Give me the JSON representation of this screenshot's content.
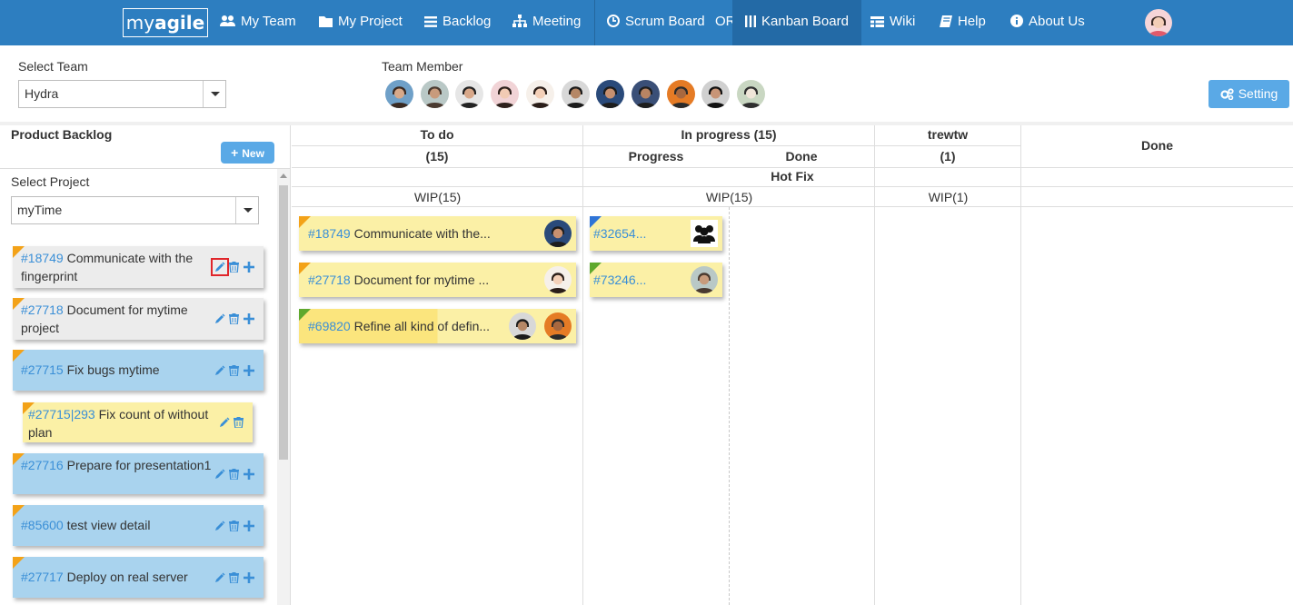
{
  "nav": {
    "logo_light": "my",
    "logo_bold": "agile",
    "items": [
      {
        "label": "My Team",
        "icon": "users-icon"
      },
      {
        "label": "My Project",
        "icon": "folder-icon"
      },
      {
        "label": "Backlog",
        "icon": "list-icon"
      },
      {
        "label": "Meeting",
        "icon": "sitemap-icon"
      },
      {
        "label": "Scrum Board",
        "icon": "clock-icon"
      },
      {
        "label": "Kanban Board",
        "icon": "columns-icon"
      },
      {
        "label": "Wiki",
        "icon": "table-icon"
      },
      {
        "label": "Help",
        "icon": "book-icon"
      },
      {
        "label": "About Us",
        "icon": "info-icon"
      }
    ],
    "or_label": "OR",
    "active": "Kanban Board",
    "color": "#2d7ec0"
  },
  "team": {
    "select_label": "Select Team",
    "selected": "Hydra",
    "member_label": "Team Member",
    "member_count": 11
  },
  "setting_label": "Setting",
  "backlog": {
    "title": "Product Backlog",
    "new_label": "New",
    "project_label": "Select Project",
    "project_selected": "myTime",
    "cards": [
      {
        "id": "#18749",
        "title": "Communicate with the fingerprint",
        "color": "grey"
      },
      {
        "id": "#27718",
        "title": "Document for mytime project",
        "color": "grey"
      },
      {
        "id": "#27715",
        "title": "Fix bugs mytime",
        "color": "blue"
      },
      {
        "id": "#27715|293",
        "title": "Fix count of without plan",
        "color": "yellow"
      },
      {
        "id": "#27716",
        "title": "Prepare for presentation1",
        "color": "blue"
      },
      {
        "id": "#85600",
        "title": "test view detail",
        "color": "blue"
      },
      {
        "id": "#27717",
        "title": "Deploy on real server",
        "color": "blue"
      }
    ]
  },
  "board": {
    "columns": [
      {
        "title": "To do",
        "count": "(15)",
        "wip": "WIP(15)"
      },
      {
        "title": "In progress (15)",
        "sub": [
          "Progress",
          "Done"
        ],
        "wip": "WIP(15)"
      },
      {
        "title": "trewtw",
        "count": "(1)",
        "wip": "WIP(1)"
      },
      {
        "title": "Done"
      }
    ],
    "swimlane": "Hot Fix",
    "todo_cards": [
      {
        "id": "#18749",
        "text": "Communicate with the..."
      },
      {
        "id": "#27718",
        "text": "Document for mytime ..."
      },
      {
        "id": "#69820",
        "text": "Refine all kind of defin..."
      }
    ],
    "progress_cards": [
      {
        "id": "#32654..."
      },
      {
        "id": "#73246..."
      }
    ]
  }
}
